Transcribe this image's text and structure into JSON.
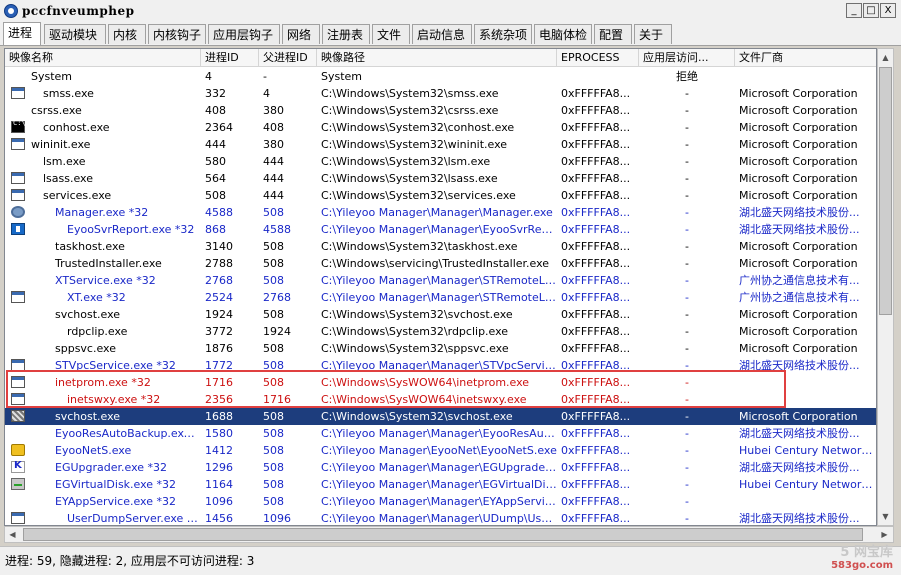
{
  "window": {
    "title": "pccfnveumphep",
    "min": "_",
    "max": "□",
    "close": "X"
  },
  "tabs": [
    "进程",
    "驱动模块",
    "内核",
    "内核钩子",
    "应用层钩子",
    "网络",
    "注册表",
    "文件",
    "启动信息",
    "系统杂项",
    "电脑体检",
    "配置",
    "关于"
  ],
  "active_tab": "进程",
  "columns": [
    "映像名称",
    "进程ID",
    "父进程ID",
    "映像路径",
    "EPROCESS",
    "应用层访问...",
    "文件厂商"
  ],
  "rows": [
    {
      "name": "System",
      "pid": "4",
      "ppid": "-",
      "path": "System",
      "eproc": "",
      "access": "拒绝",
      "vendor": "",
      "style": "normal",
      "icon": "none",
      "indent": 1
    },
    {
      "name": "smss.exe",
      "pid": "332",
      "ppid": "4",
      "path": "C:\\Windows\\System32\\smss.exe",
      "eproc": "0xFFFFFA8...",
      "access": "-",
      "vendor": "Microsoft Corporation",
      "style": "normal",
      "icon": "win",
      "indent": 2
    },
    {
      "name": "csrss.exe",
      "pid": "408",
      "ppid": "380",
      "path": "C:\\Windows\\System32\\csrss.exe",
      "eproc": "0xFFFFFA8...",
      "access": "-",
      "vendor": "Microsoft Corporation",
      "style": "normal",
      "icon": "none",
      "indent": 0
    },
    {
      "name": "conhost.exe",
      "pid": "2364",
      "ppid": "408",
      "path": "C:\\Windows\\System32\\conhost.exe",
      "eproc": "0xFFFFFA8...",
      "access": "-",
      "vendor": "Microsoft Corporation",
      "style": "normal",
      "icon": "cmd",
      "indent": 2
    },
    {
      "name": "wininit.exe",
      "pid": "444",
      "ppid": "380",
      "path": "C:\\Windows\\System32\\wininit.exe",
      "eproc": "0xFFFFFA8...",
      "access": "-",
      "vendor": "Microsoft Corporation",
      "style": "normal",
      "icon": "win",
      "indent": 0
    },
    {
      "name": "lsm.exe",
      "pid": "580",
      "ppid": "444",
      "path": "C:\\Windows\\System32\\lsm.exe",
      "eproc": "0xFFFFFA8...",
      "access": "-",
      "vendor": "Microsoft Corporation",
      "style": "normal",
      "icon": "none",
      "indent": 2
    },
    {
      "name": "lsass.exe",
      "pid": "564",
      "ppid": "444",
      "path": "C:\\Windows\\System32\\lsass.exe",
      "eproc": "0xFFFFFA8...",
      "access": "-",
      "vendor": "Microsoft Corporation",
      "style": "normal",
      "icon": "win",
      "indent": 2
    },
    {
      "name": "services.exe",
      "pid": "508",
      "ppid": "444",
      "path": "C:\\Windows\\System32\\services.exe",
      "eproc": "0xFFFFFA8...",
      "access": "-",
      "vendor": "Microsoft Corporation",
      "style": "normal",
      "icon": "win",
      "indent": 2
    },
    {
      "name": "Manager.exe *32",
      "pid": "4588",
      "ppid": "508",
      "path": "C:\\Yileyoo Manager\\Manager\\Manager.exe",
      "eproc": "0xFFFFFA8...",
      "access": "-",
      "vendor": "湖北盛天网络技术股份...",
      "style": "blue",
      "icon": "gear",
      "indent": 3
    },
    {
      "name": "EyooSvrReport.exe *32",
      "pid": "868",
      "ppid": "4588",
      "path": "C:\\Yileyoo Manager\\Manager\\EyooSvrRepor...",
      "eproc": "0xFFFFFA8...",
      "access": "-",
      "vendor": "湖北盛天网络技术股份...",
      "style": "blue",
      "icon": "blue",
      "indent": 4
    },
    {
      "name": "taskhost.exe",
      "pid": "3140",
      "ppid": "508",
      "path": "C:\\Windows\\System32\\taskhost.exe",
      "eproc": "0xFFFFFA8...",
      "access": "-",
      "vendor": "Microsoft Corporation",
      "style": "normal",
      "icon": "none",
      "indent": 3
    },
    {
      "name": "TrustedInstaller.exe",
      "pid": "2788",
      "ppid": "508",
      "path": "C:\\Windows\\servicing\\TrustedInstaller.exe",
      "eproc": "0xFFFFFA8...",
      "access": "-",
      "vendor": "Microsoft Corporation",
      "style": "normal",
      "icon": "none",
      "indent": 3
    },
    {
      "name": "XTService.exe *32",
      "pid": "2768",
      "ppid": "508",
      "path": "C:\\Yileyoo Manager\\Manager\\STRemoteLibr...",
      "eproc": "0xFFFFFA8...",
      "access": "-",
      "vendor": "广州协之通信息技术有...",
      "style": "blue",
      "icon": "none",
      "indent": 3
    },
    {
      "name": "XT.exe *32",
      "pid": "2524",
      "ppid": "2768",
      "path": "C:\\Yileyoo Manager\\Manager\\STRemoteLibr...",
      "eproc": "0xFFFFFA8...",
      "access": "-",
      "vendor": "广州协之通信息技术有...",
      "style": "blue",
      "icon": "win",
      "indent": 4
    },
    {
      "name": "svchost.exe",
      "pid": "1924",
      "ppid": "508",
      "path": "C:\\Windows\\System32\\svchost.exe",
      "eproc": "0xFFFFFA8...",
      "access": "-",
      "vendor": "Microsoft Corporation",
      "style": "normal",
      "icon": "none",
      "indent": 3
    },
    {
      "name": "rdpclip.exe",
      "pid": "3772",
      "ppid": "1924",
      "path": "C:\\Windows\\System32\\rdpclip.exe",
      "eproc": "0xFFFFFA8...",
      "access": "-",
      "vendor": "Microsoft Corporation",
      "style": "normal",
      "icon": "none",
      "indent": 4
    },
    {
      "name": "sppsvc.exe",
      "pid": "1876",
      "ppid": "508",
      "path": "C:\\Windows\\System32\\sppsvc.exe",
      "eproc": "0xFFFFFA8...",
      "access": "-",
      "vendor": "Microsoft Corporation",
      "style": "normal",
      "icon": "none",
      "indent": 3
    },
    {
      "name": "STVpcService.exe *32",
      "pid": "1772",
      "ppid": "508",
      "path": "C:\\Yileyoo Manager\\Manager\\STVpcService...",
      "eproc": "0xFFFFFA8...",
      "access": "-",
      "vendor": "湖北盛天网络技术股份...",
      "style": "blue",
      "icon": "win",
      "indent": 3
    },
    {
      "name": "inetprom.exe *32",
      "pid": "1716",
      "ppid": "508",
      "path": "C:\\Windows\\SysWOW64\\inetprom.exe",
      "eproc": "0xFFFFFA8...",
      "access": "-",
      "vendor": "",
      "style": "red",
      "icon": "win",
      "indent": 3
    },
    {
      "name": "inetswxy.exe *32",
      "pid": "2356",
      "ppid": "1716",
      "path": "C:\\Windows\\SysWOW64\\inetswxy.exe",
      "eproc": "0xFFFFFA8...",
      "access": "-",
      "vendor": "",
      "style": "red",
      "icon": "win",
      "indent": 4
    },
    {
      "name": "svchost.exe",
      "pid": "1688",
      "ppid": "508",
      "path": "C:\\Windows\\System32\\svchost.exe",
      "eproc": "0xFFFFFA8...",
      "access": "-",
      "vendor": "Microsoft Corporation",
      "style": "sel",
      "icon": "grid",
      "indent": 3
    },
    {
      "name": "EyooResAutoBackup.exe *32",
      "pid": "1580",
      "ppid": "508",
      "path": "C:\\Yileyoo Manager\\Manager\\EyooResAutoB...",
      "eproc": "0xFFFFFA8...",
      "access": "-",
      "vendor": "湖北盛天网络技术股份...",
      "style": "blue",
      "icon": "none",
      "indent": 3
    },
    {
      "name": "EyooNetS.exe",
      "pid": "1412",
      "ppid": "508",
      "path": "C:\\Yileyoo Manager\\EyooNet\\EyooNetS.exe",
      "eproc": "0xFFFFFA8...",
      "access": "-",
      "vendor": "Hubei Century Network Te...",
      "style": "blue",
      "icon": "yellow",
      "indent": 3
    },
    {
      "name": "EGUpgrader.exe *32",
      "pid": "1296",
      "ppid": "508",
      "path": "C:\\Yileyoo Manager\\Manager\\EGUpgrader.exe",
      "eproc": "0xFFFFFA8...",
      "access": "-",
      "vendor": "湖北盛天网络技术股份...",
      "style": "blue",
      "icon": "k",
      "indent": 3
    },
    {
      "name": "EGVirtualDisk.exe *32",
      "pid": "1164",
      "ppid": "508",
      "path": "C:\\Yileyoo Manager\\Manager\\EGVirtualDisk...",
      "eproc": "0xFFFFFA8...",
      "access": "-",
      "vendor": "Hubei Century Network Te...",
      "style": "blue",
      "icon": "drive",
      "indent": 3
    },
    {
      "name": "EYAppService.exe *32",
      "pid": "1096",
      "ppid": "508",
      "path": "C:\\Yileyoo Manager\\Manager\\EYAppService...",
      "eproc": "0xFFFFFA8...",
      "access": "-",
      "vendor": "",
      "style": "blue",
      "icon": "none",
      "indent": 3
    },
    {
      "name": "UserDumpServer.exe *32",
      "pid": "1456",
      "ppid": "1096",
      "path": "C:\\Yileyoo Manager\\Manager\\UDump\\UserD...",
      "eproc": "0xFFFFFA8...",
      "access": "-",
      "vendor": "湖北盛天网络技术股份...",
      "style": "blue",
      "icon": "win",
      "indent": 4
    }
  ],
  "status": "进程: 59, 隐藏进程: 2, 应用层不可访问进程: 3",
  "watermark": {
    "line1": "5 网宝库",
    "line2": "583go.com"
  },
  "colors": {
    "selection": "#1d3d7d",
    "blue_text": "#1a28c8",
    "red_text": "#cc1010",
    "highlight_box": "#e04040"
  }
}
